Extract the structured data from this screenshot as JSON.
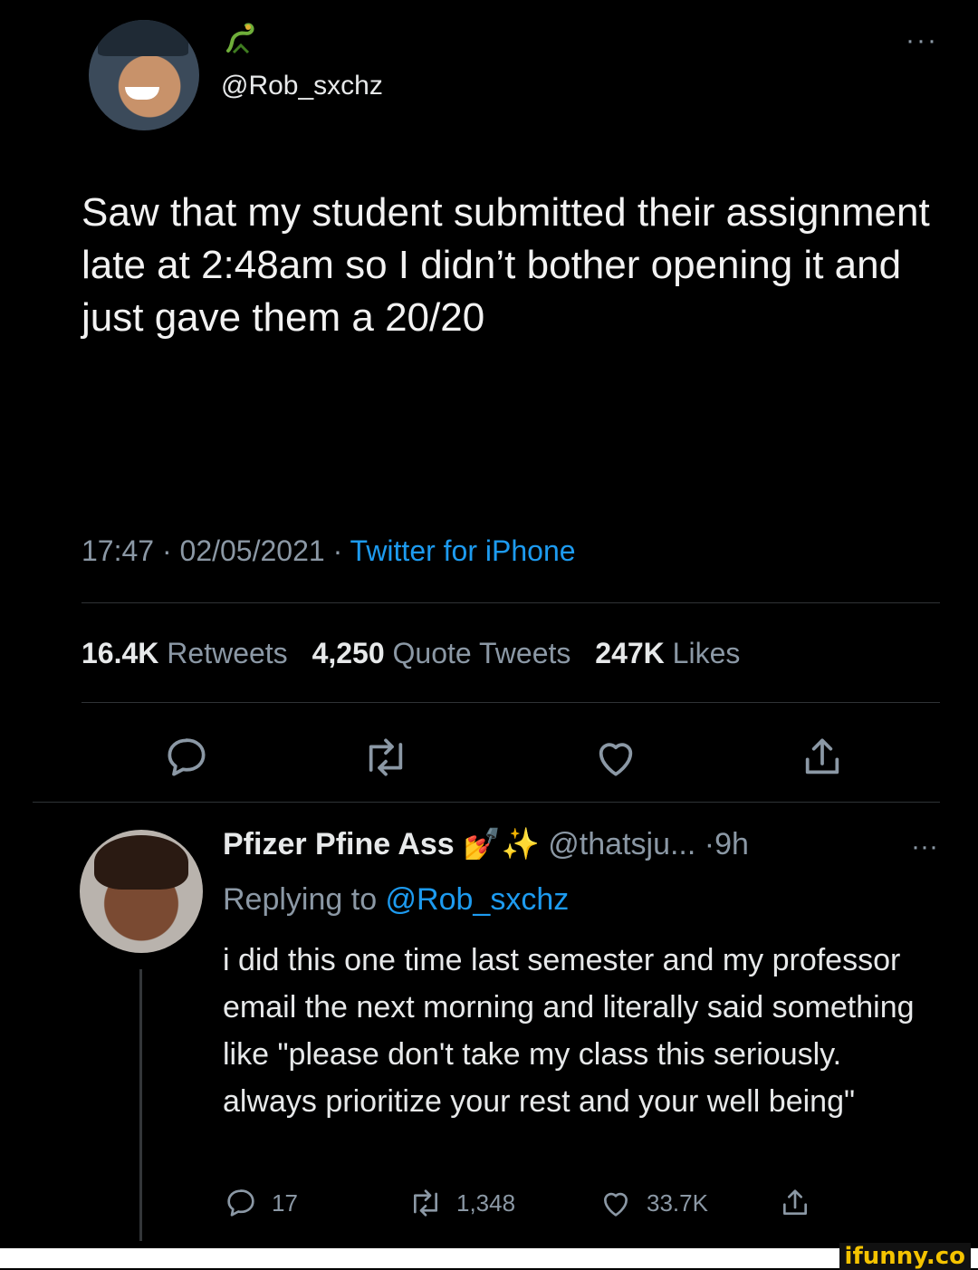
{
  "main_tweet": {
    "handle": "@Rob_sxchz",
    "text": "Saw that my student submitted their assignment late at 2:48am so I didn’t bother opening it and just gave them a 20/20",
    "time": "17:47 · 02/05/2021 · ",
    "source": "Twitter for iPhone",
    "stats": {
      "retweets_count": "16.4K",
      "retweets_label": "Retweets",
      "quotes_count": "4,250",
      "quotes_label": "Quote Tweets",
      "likes_count": "247K",
      "likes_label": "Likes"
    },
    "more": "···"
  },
  "reply": {
    "name": "Pfizer Pfine Ass",
    "emoji": "💅✨",
    "handle": "@thatsju...",
    "time": "·9h",
    "more": "···",
    "replying_prefix": "Replying to ",
    "replying_to": "@Rob_sxchz",
    "text": "i did this one time last semester and my professor email the next morning and literally said something like \"please don't take my class this seriously. always prioritize your rest and your well being\"",
    "counts": {
      "replies": "17",
      "retweets": "1,348",
      "likes": "33.7K"
    }
  },
  "watermark": "ifunny.co",
  "colors": {
    "background": "#000000",
    "link": "#1d9bf0",
    "muted": "#8b98a5",
    "text": "#e7e9ea"
  }
}
